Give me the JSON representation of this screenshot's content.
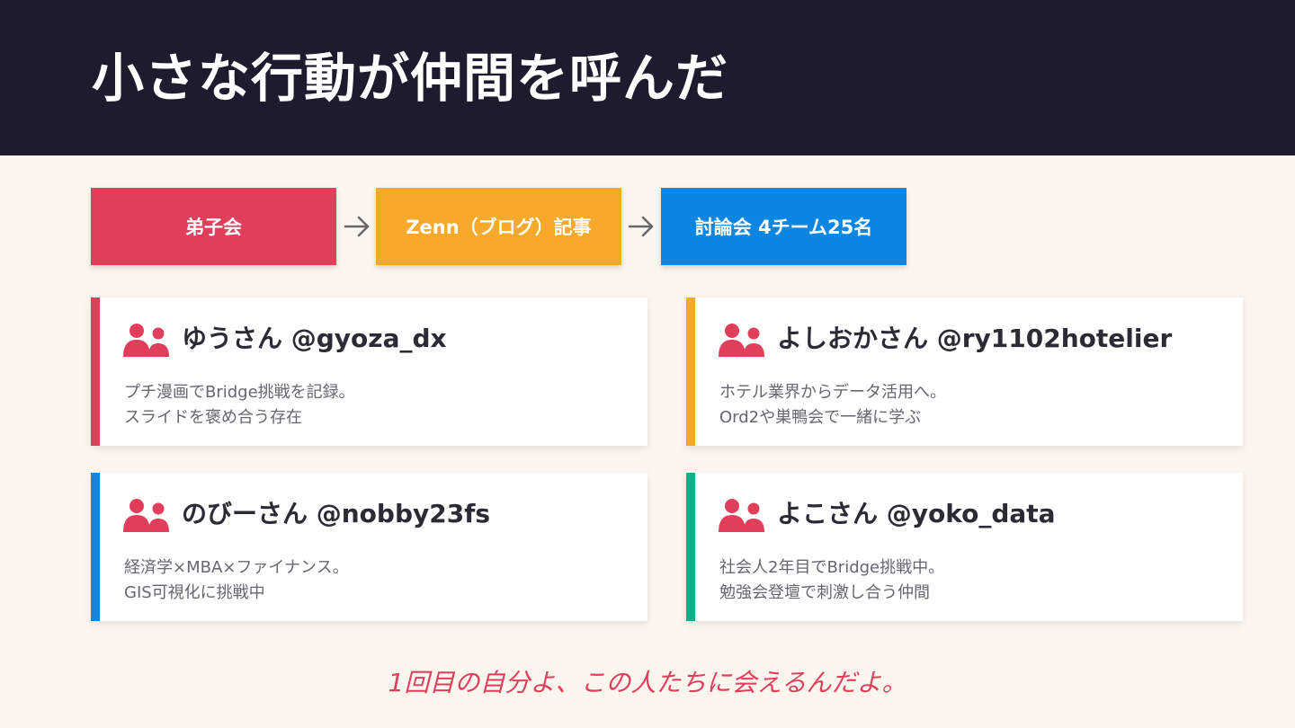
{
  "title": "小さな行動が仲間を呼んだ",
  "flow": [
    {
      "label": "弟子会",
      "color": "#e03f5c"
    },
    {
      "label": "Zenn（ブログ）記事",
      "color": "#f7a92b"
    },
    {
      "label": "討論会 4チーム25名",
      "color": "#0c86e3"
    }
  ],
  "arrow_icon": "arrow-right-icon",
  "people_icon": "people-icon",
  "members": [
    {
      "name": "ゆうさん @gyoza_dx",
      "lines": [
        "プチ漫画でBridge挑戦を記録。",
        "スライドを褒め合う存在"
      ],
      "color": "#e03f5c"
    },
    {
      "name": "よしおかさん  @ry1102hotelier",
      "lines": [
        "ホテル業界からデータ活用へ。",
        "Ord2や巣鴨会で一緒に学ぶ"
      ],
      "color": "#f7a92b"
    },
    {
      "name": "のびーさん @nobby23fs",
      "lines": [
        "経済学×MBA×ファイナンス。",
        "GIS可視化に挑戦中"
      ],
      "color": "#0c86e3"
    },
    {
      "name": "よこさん @yoko_data",
      "lines": [
        "社会人2年目でBridge挑戦中。",
        "勉強会登壇で刺激し合う仲間"
      ],
      "color": "#12b08a"
    }
  ],
  "footer": "1回目の自分よ、この人たちに会えるんだよ。"
}
